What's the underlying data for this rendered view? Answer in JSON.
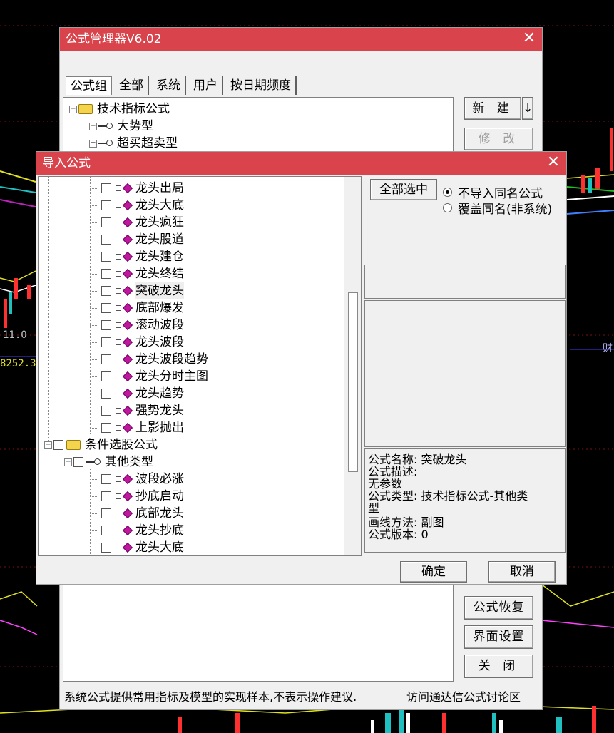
{
  "background": {
    "price_label": "11.0",
    "volume_label": "8252.3",
    "side_label": "财"
  },
  "manager": {
    "title": "公式管理器V6.02",
    "tabs": [
      "公式组",
      "全部",
      "系统",
      "用户",
      "按日期频度"
    ],
    "tree": [
      {
        "label": "技术指标公式",
        "type": "folder"
      },
      {
        "label": "大势型",
        "type": "key"
      },
      {
        "label": "超买超卖型",
        "type": "key"
      }
    ],
    "buttons": {
      "new": "新 建",
      "new_arrow": "↓",
      "modify": "修 改",
      "restore": "公式恢复",
      "ui_settings": "界面设置",
      "close": "关 闭"
    },
    "status": "系统公式提供常用指标及模型的实现样本,不表示操作建议.",
    "forum_link": "访问通达信公式讨论区"
  },
  "import_dialog": {
    "title": "导入公式",
    "select_all": "全部选中",
    "radio_skip": "不导入同名公式",
    "radio_overwrite": "覆盖同名(非系统)",
    "items_group1": [
      "龙头出局",
      "龙头大底",
      "龙头疯狂",
      "龙头股道",
      "龙头建仓",
      "龙头终结",
      "突破龙头",
      "底部爆发",
      "滚动波段",
      "龙头波段",
      "龙头波段趋势",
      "龙头分时主图",
      "龙头趋势",
      "强势龙头",
      "上影抛出"
    ],
    "folder2": "条件选股公式",
    "subfolder2": "其他类型",
    "items_group2": [
      "波段必涨",
      "抄底启动",
      "底部龙头",
      "龙头抄底",
      "龙头大底"
    ],
    "info": {
      "name_label": "公式名称:",
      "name_value": "突破龙头",
      "desc_label": "公式描述:",
      "no_params": "无参数",
      "type_label": "公式类型:",
      "type_value": "技术指标公式-其他类",
      "type_wrap": "型",
      "draw_label": "画线方法:",
      "draw_value": "副图",
      "version_label": "公式版本:",
      "version_value": "0"
    },
    "ok": "确定",
    "cancel": "取消"
  }
}
